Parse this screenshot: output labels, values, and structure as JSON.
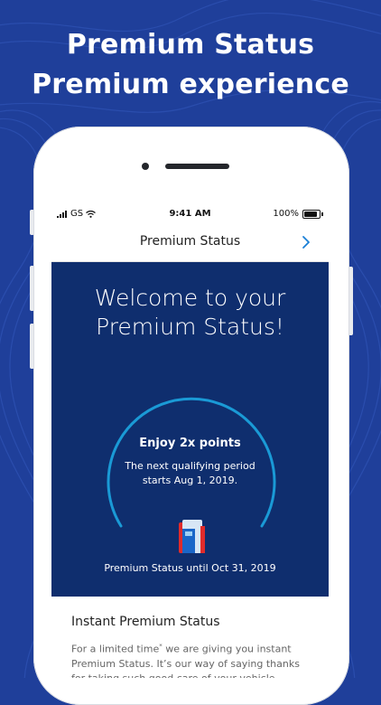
{
  "headline": {
    "line1": "Premium Status",
    "line2": "Premium experience"
  },
  "status_bar": {
    "carrier": "GS",
    "time": "9:41 AM",
    "battery": "100%"
  },
  "navbar": {
    "title": "Premium Status",
    "chevron_icon": "chevron-right-icon"
  },
  "hero": {
    "title_line1": "Welcome to your",
    "title_line2": "Premium Status!",
    "gauge_headline": "Enjoy 2x points",
    "gauge_sub_line1": "The next qualifying period",
    "gauge_sub_line2": "starts Aug 1, 2019.",
    "status_until": "Premium Status until Oct  31, 2019",
    "icon": "gas-pump-icon"
  },
  "info": {
    "title": "Instant Premium Status",
    "body_part1": "For a limited time",
    "body_sup": "*",
    "body_part2": " we are giving you instant Premium Status. It’s our way of saying thanks for taking such good care of your vehicle."
  },
  "colors": {
    "background": "#1f3f9a",
    "hero": "#0f2e6e",
    "gauge_arc": "#1a9ad6",
    "accent_red": "#e02b2b",
    "accent_blue": "#1a66c8"
  }
}
